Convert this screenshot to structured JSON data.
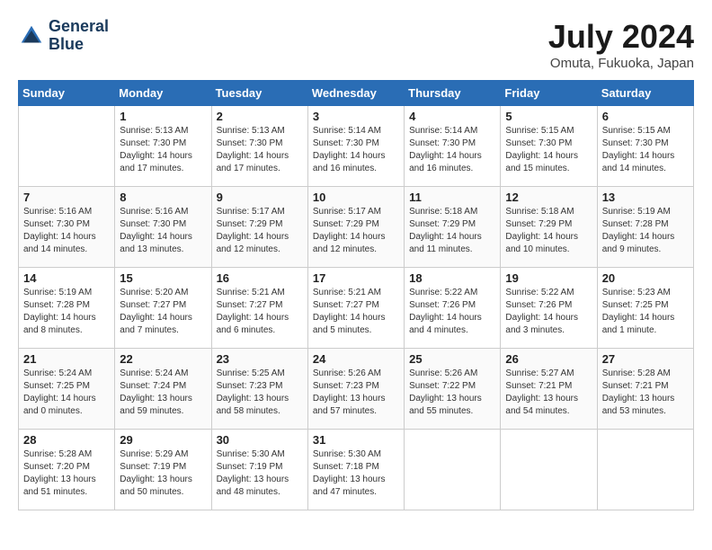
{
  "header": {
    "logo_line1": "General",
    "logo_line2": "Blue",
    "month_title": "July 2024",
    "location": "Omuta, Fukuoka, Japan"
  },
  "weekdays": [
    "Sunday",
    "Monday",
    "Tuesday",
    "Wednesday",
    "Thursday",
    "Friday",
    "Saturday"
  ],
  "weeks": [
    [
      {
        "day": "",
        "sunrise": "",
        "sunset": "",
        "daylight": ""
      },
      {
        "day": "1",
        "sunrise": "Sunrise: 5:13 AM",
        "sunset": "Sunset: 7:30 PM",
        "daylight": "Daylight: 14 hours and 17 minutes."
      },
      {
        "day": "2",
        "sunrise": "Sunrise: 5:13 AM",
        "sunset": "Sunset: 7:30 PM",
        "daylight": "Daylight: 14 hours and 17 minutes."
      },
      {
        "day": "3",
        "sunrise": "Sunrise: 5:14 AM",
        "sunset": "Sunset: 7:30 PM",
        "daylight": "Daylight: 14 hours and 16 minutes."
      },
      {
        "day": "4",
        "sunrise": "Sunrise: 5:14 AM",
        "sunset": "Sunset: 7:30 PM",
        "daylight": "Daylight: 14 hours and 16 minutes."
      },
      {
        "day": "5",
        "sunrise": "Sunrise: 5:15 AM",
        "sunset": "Sunset: 7:30 PM",
        "daylight": "Daylight: 14 hours and 15 minutes."
      },
      {
        "day": "6",
        "sunrise": "Sunrise: 5:15 AM",
        "sunset": "Sunset: 7:30 PM",
        "daylight": "Daylight: 14 hours and 14 minutes."
      }
    ],
    [
      {
        "day": "7",
        "sunrise": "Sunrise: 5:16 AM",
        "sunset": "Sunset: 7:30 PM",
        "daylight": "Daylight: 14 hours and 14 minutes."
      },
      {
        "day": "8",
        "sunrise": "Sunrise: 5:16 AM",
        "sunset": "Sunset: 7:30 PM",
        "daylight": "Daylight: 14 hours and 13 minutes."
      },
      {
        "day": "9",
        "sunrise": "Sunrise: 5:17 AM",
        "sunset": "Sunset: 7:29 PM",
        "daylight": "Daylight: 14 hours and 12 minutes."
      },
      {
        "day": "10",
        "sunrise": "Sunrise: 5:17 AM",
        "sunset": "Sunset: 7:29 PM",
        "daylight": "Daylight: 14 hours and 12 minutes."
      },
      {
        "day": "11",
        "sunrise": "Sunrise: 5:18 AM",
        "sunset": "Sunset: 7:29 PM",
        "daylight": "Daylight: 14 hours and 11 minutes."
      },
      {
        "day": "12",
        "sunrise": "Sunrise: 5:18 AM",
        "sunset": "Sunset: 7:29 PM",
        "daylight": "Daylight: 14 hours and 10 minutes."
      },
      {
        "day": "13",
        "sunrise": "Sunrise: 5:19 AM",
        "sunset": "Sunset: 7:28 PM",
        "daylight": "Daylight: 14 hours and 9 minutes."
      }
    ],
    [
      {
        "day": "14",
        "sunrise": "Sunrise: 5:19 AM",
        "sunset": "Sunset: 7:28 PM",
        "daylight": "Daylight: 14 hours and 8 minutes."
      },
      {
        "day": "15",
        "sunrise": "Sunrise: 5:20 AM",
        "sunset": "Sunset: 7:27 PM",
        "daylight": "Daylight: 14 hours and 7 minutes."
      },
      {
        "day": "16",
        "sunrise": "Sunrise: 5:21 AM",
        "sunset": "Sunset: 7:27 PM",
        "daylight": "Daylight: 14 hours and 6 minutes."
      },
      {
        "day": "17",
        "sunrise": "Sunrise: 5:21 AM",
        "sunset": "Sunset: 7:27 PM",
        "daylight": "Daylight: 14 hours and 5 minutes."
      },
      {
        "day": "18",
        "sunrise": "Sunrise: 5:22 AM",
        "sunset": "Sunset: 7:26 PM",
        "daylight": "Daylight: 14 hours and 4 minutes."
      },
      {
        "day": "19",
        "sunrise": "Sunrise: 5:22 AM",
        "sunset": "Sunset: 7:26 PM",
        "daylight": "Daylight: 14 hours and 3 minutes."
      },
      {
        "day": "20",
        "sunrise": "Sunrise: 5:23 AM",
        "sunset": "Sunset: 7:25 PM",
        "daylight": "Daylight: 14 hours and 1 minute."
      }
    ],
    [
      {
        "day": "21",
        "sunrise": "Sunrise: 5:24 AM",
        "sunset": "Sunset: 7:25 PM",
        "daylight": "Daylight: 14 hours and 0 minutes."
      },
      {
        "day": "22",
        "sunrise": "Sunrise: 5:24 AM",
        "sunset": "Sunset: 7:24 PM",
        "daylight": "Daylight: 13 hours and 59 minutes."
      },
      {
        "day": "23",
        "sunrise": "Sunrise: 5:25 AM",
        "sunset": "Sunset: 7:23 PM",
        "daylight": "Daylight: 13 hours and 58 minutes."
      },
      {
        "day": "24",
        "sunrise": "Sunrise: 5:26 AM",
        "sunset": "Sunset: 7:23 PM",
        "daylight": "Daylight: 13 hours and 57 minutes."
      },
      {
        "day": "25",
        "sunrise": "Sunrise: 5:26 AM",
        "sunset": "Sunset: 7:22 PM",
        "daylight": "Daylight: 13 hours and 55 minutes."
      },
      {
        "day": "26",
        "sunrise": "Sunrise: 5:27 AM",
        "sunset": "Sunset: 7:21 PM",
        "daylight": "Daylight: 13 hours and 54 minutes."
      },
      {
        "day": "27",
        "sunrise": "Sunrise: 5:28 AM",
        "sunset": "Sunset: 7:21 PM",
        "daylight": "Daylight: 13 hours and 53 minutes."
      }
    ],
    [
      {
        "day": "28",
        "sunrise": "Sunrise: 5:28 AM",
        "sunset": "Sunset: 7:20 PM",
        "daylight": "Daylight: 13 hours and 51 minutes."
      },
      {
        "day": "29",
        "sunrise": "Sunrise: 5:29 AM",
        "sunset": "Sunset: 7:19 PM",
        "daylight": "Daylight: 13 hours and 50 minutes."
      },
      {
        "day": "30",
        "sunrise": "Sunrise: 5:30 AM",
        "sunset": "Sunset: 7:19 PM",
        "daylight": "Daylight: 13 hours and 48 minutes."
      },
      {
        "day": "31",
        "sunrise": "Sunrise: 5:30 AM",
        "sunset": "Sunset: 7:18 PM",
        "daylight": "Daylight: 13 hours and 47 minutes."
      },
      {
        "day": "",
        "sunrise": "",
        "sunset": "",
        "daylight": ""
      },
      {
        "day": "",
        "sunrise": "",
        "sunset": "",
        "daylight": ""
      },
      {
        "day": "",
        "sunrise": "",
        "sunset": "",
        "daylight": ""
      }
    ]
  ]
}
